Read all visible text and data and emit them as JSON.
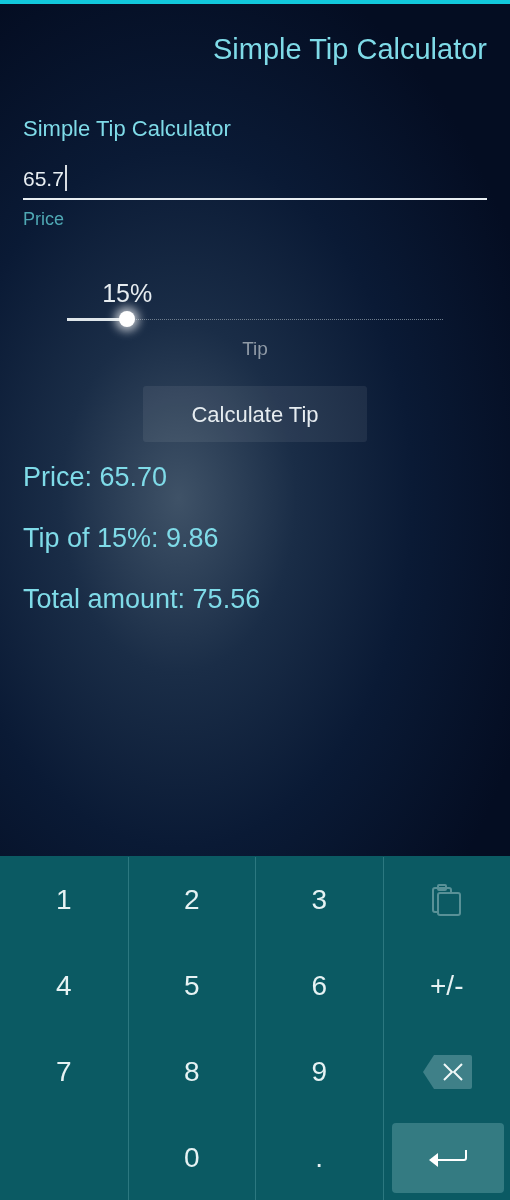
{
  "header": {
    "title": "Simple Tip Calculator"
  },
  "form": {
    "heading": "Simple Tip Calculator",
    "price_field": {
      "value": "65.7",
      "label": "Price"
    },
    "tip_slider": {
      "reading": "15%",
      "label": "Tip",
      "level": 0.16
    },
    "button": "Calculate Tip"
  },
  "results": [
    "Price: 65.70",
    "Tip of 15%: 9.86",
    "Total amount: 75.56"
  ],
  "keyboard": {
    "rows": [
      [
        {
          "kind": "char",
          "label": "1"
        },
        {
          "kind": "char",
          "label": "2"
        },
        {
          "kind": "char",
          "label": "3"
        },
        {
          "kind": "paste",
          "disabled": true
        }
      ],
      [
        {
          "kind": "char",
          "label": "4"
        },
        {
          "kind": "char",
          "label": "5"
        },
        {
          "kind": "char",
          "label": "6"
        },
        {
          "kind": "char",
          "label": "+/-"
        }
      ],
      [
        {
          "kind": "char",
          "label": "7"
        },
        {
          "kind": "char",
          "label": "8"
        },
        {
          "kind": "char",
          "label": "9"
        },
        {
          "kind": "backspace"
        }
      ],
      [
        {
          "kind": "gap"
        },
        {
          "kind": "char",
          "label": "0"
        },
        {
          "kind": "char",
          "label": "."
        },
        {
          "kind": "enter"
        }
      ]
    ]
  }
}
